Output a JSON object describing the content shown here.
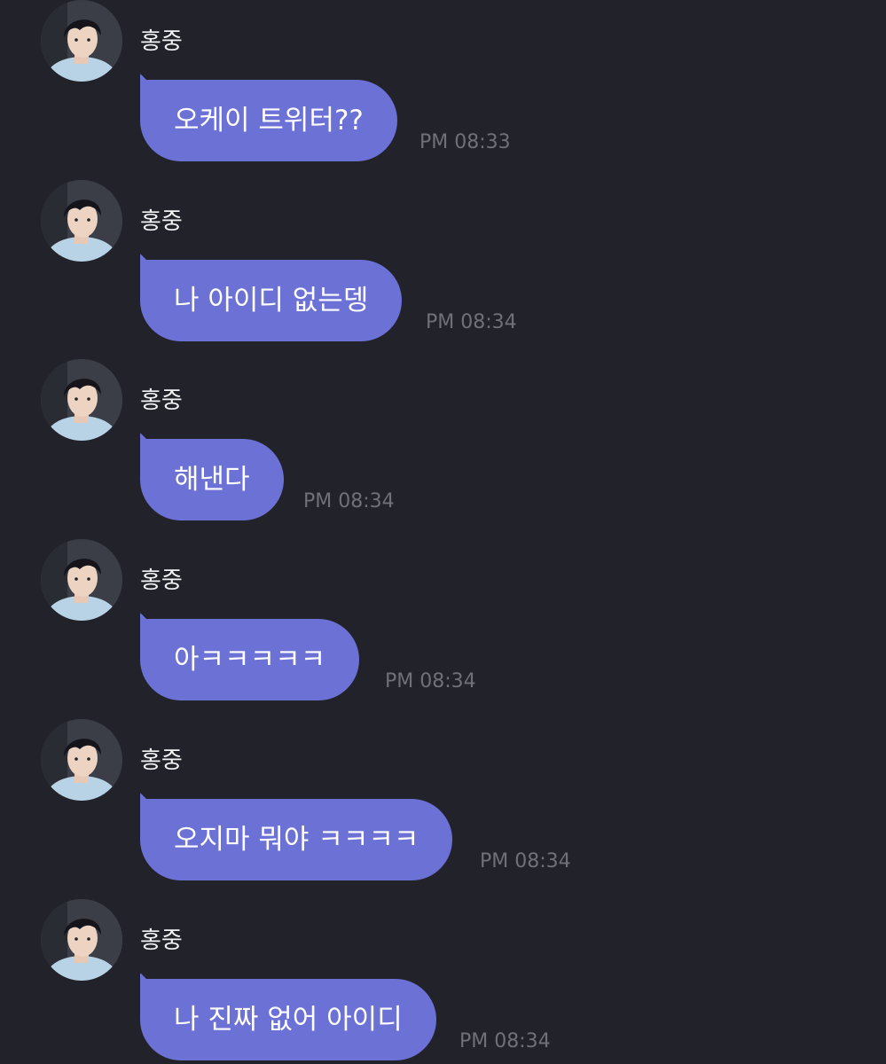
{
  "colors": {
    "background": "#22222a",
    "bubble": "#6c71d5",
    "text": "#ffffff",
    "timestamp": "#6f7079"
  },
  "messages": [
    {
      "sender": "홍중",
      "avatar_icon": "user-avatar-photo",
      "text": "오케이 트위터??",
      "time": "PM 08:33"
    },
    {
      "sender": "홍중",
      "avatar_icon": "user-avatar-photo",
      "text": "나 아이디 없는뎅",
      "time": "PM 08:34"
    },
    {
      "sender": "홍중",
      "avatar_icon": "user-avatar-photo",
      "text": "해낸다",
      "time": "PM 08:34"
    },
    {
      "sender": "홍중",
      "avatar_icon": "user-avatar-photo",
      "text": "아ㅋㅋㅋㅋㅋ",
      "time": "PM 08:34"
    },
    {
      "sender": "홍중",
      "avatar_icon": "user-avatar-photo",
      "text": "오지마 뭐야 ㅋㅋㅋㅋ",
      "time": "PM 08:34"
    },
    {
      "sender": "홍중",
      "avatar_icon": "user-avatar-photo",
      "text": "나 진짜 없어 아이디",
      "time": "PM 08:34"
    }
  ]
}
